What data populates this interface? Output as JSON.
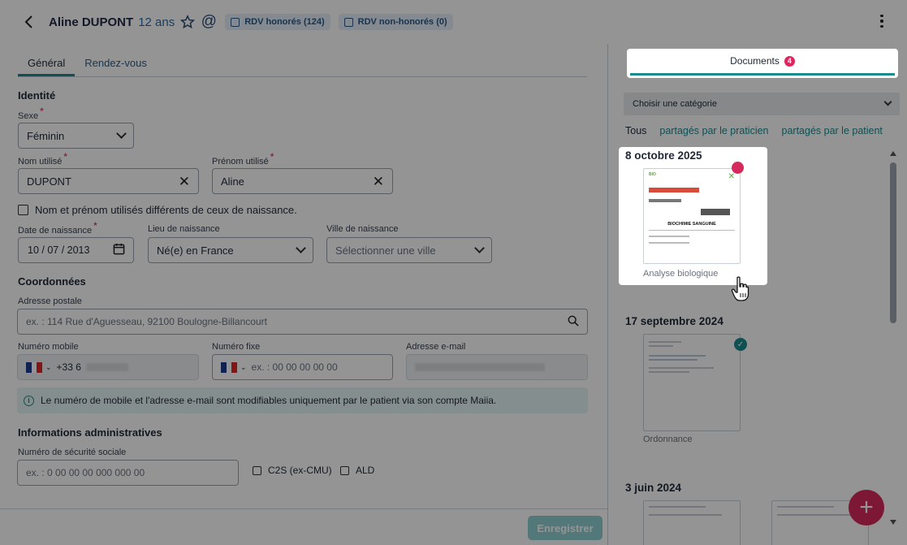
{
  "header": {
    "name": "Aline DUPONT",
    "age": "12 ans",
    "badges": [
      {
        "label": "RDV honorés (124)"
      },
      {
        "label": "RDV non-honorés (0)"
      }
    ]
  },
  "tabs": [
    {
      "label": "Général",
      "active": true
    },
    {
      "label": "Rendez-vous",
      "active": false
    }
  ],
  "identite": {
    "section": "Identité",
    "sexe_label": "Sexe",
    "sexe_value": "Féminin",
    "nom_label": "Nom utilisé",
    "nom_value": "DUPONT",
    "prenom_label": "Prénom utilisé",
    "prenom_value": "Aline",
    "checkbox_label": "Nom et prénom utilisés différents de ceux de naissance.",
    "naissance_label": "Date de naissance",
    "naissance_value": "10 / 07 / 2013",
    "lieu_label": "Lieu de naissance",
    "lieu_value": "Né(e) en France",
    "ville_label": "Ville de naissance",
    "ville_placeholder": "Sélectionner une ville"
  },
  "coordonnees": {
    "section": "Coordonnées",
    "adresse_label": "Adresse postale",
    "adresse_placeholder": "ex. : 114 Rue d'Aguesseau, 92100 Boulogne-Billancourt",
    "mobile_label": "Numéro mobile",
    "mobile_prefix": "+33 6",
    "fixe_label": "Numéro fixe",
    "fixe_placeholder": "ex. : 00 00 00 00 00",
    "email_label": "Adresse e-mail",
    "info": "Le numéro de mobile et l'adresse e-mail sont modifiables uniquement par le patient via son compte Maiia."
  },
  "admin": {
    "section": "Informations administratives",
    "secu_label": "Numéro de sécurité sociale",
    "secu_placeholder": "ex. : 0 00 00 00 000 000 00",
    "c2s_label": "C2S (ex-CMU)",
    "ald_label": "ALD"
  },
  "save_label": "Enregistrer",
  "documents": {
    "tab_label": "Documents",
    "count": "4",
    "category_placeholder": "Choisir une catégorie",
    "filters": [
      "Tous",
      "partagés par le praticien",
      "partagés par le patient"
    ],
    "groups": [
      {
        "date": "8 octobre 2025",
        "items": [
          {
            "caption": "Analyse biologique",
            "status": "unread"
          }
        ]
      },
      {
        "date": "17 septembre 2024",
        "items": [
          {
            "caption": "Ordonnance",
            "status": "read"
          }
        ]
      },
      {
        "date": "3 juin 2024",
        "items": []
      }
    ],
    "doc_title": "BIOCHIMIE SANGUINE"
  },
  "colors": {
    "accent": "#1a8b8f",
    "brand_pink": "#d62a5e",
    "link": "#2a5d8c"
  }
}
